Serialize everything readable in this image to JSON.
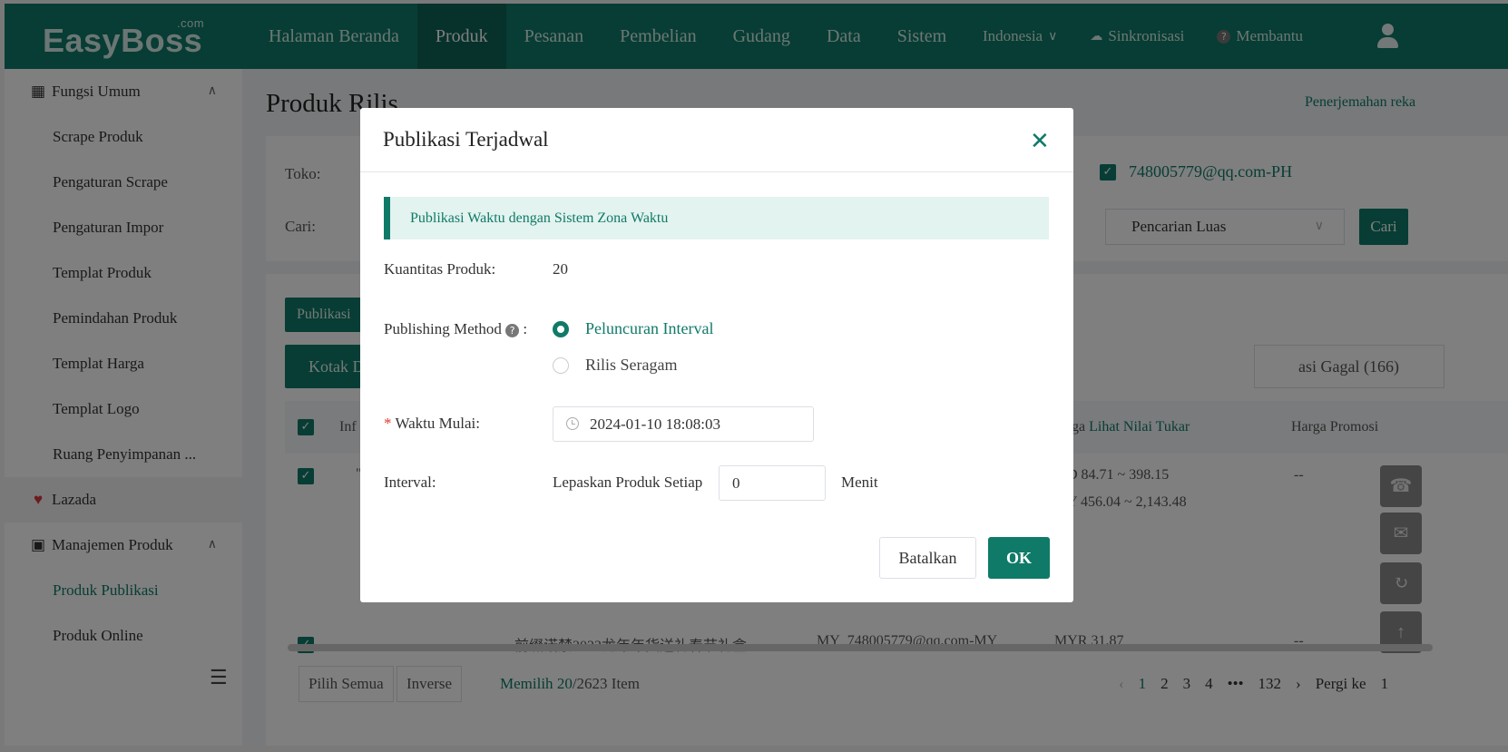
{
  "app": {
    "logo": "EasyBoss",
    "logo_sup": ".com"
  },
  "nav": {
    "items": [
      "Halaman Beranda",
      "Produk",
      "Pesanan",
      "Pembelian",
      "Gudang",
      "Data",
      "Sistem"
    ],
    "active": "Produk",
    "language": "Indonesia",
    "sync": "Sinkronisasi",
    "help": "Membantu"
  },
  "sidebar": {
    "group1": "Fungsi Umum",
    "items": [
      "Scrape Produk",
      "Pengaturan Scrape",
      "Pengaturan Impor",
      "Templat Produk",
      "Pemindahan Produk",
      "Templat Harga",
      "Templat Logo",
      "Ruang Penyimpanan ..."
    ],
    "lazada": "Lazada",
    "group2": "Manajemen Produk",
    "sub_items": [
      "Produk Publikasi",
      "Produk Online"
    ],
    "active": "Produk Publikasi"
  },
  "main": {
    "title": "Produk Rilis",
    "translate_link": "Penerjemahan reka",
    "filter": {
      "shop_label": "Toko:",
      "shop_checked": "748005779@qq.com-PH",
      "search_label": "Cari:",
      "search_mode": "Pencarian Luas",
      "search_button": "Cari"
    },
    "publish_button": "Publikasi",
    "tab_box": "Kotak D",
    "tab_failed": "asi Gagal (166)",
    "table": {
      "col_info": "Inf",
      "col_price_prefix": "rga ",
      "col_price_link": "Lihat Nilai Tukar",
      "col_promo": "Harga Promosi",
      "row1": {
        "name": "\"",
        "price1": "D 84.71 ~ 398.15",
        "price2": "Y 456.04 ~ 2,143.48",
        "promo": "--"
      },
      "row2": {
        "name": "前缀诺禁2023龙年年货送礼春节礼盒",
        "shop": "MY_748005779@qq.com-MY",
        "price": "MYR 31.87",
        "promo": "--"
      }
    },
    "footer": {
      "select_all": "Pilih Semua",
      "inverse": "Inverse",
      "selected_prefix": "Memilih",
      "selected_count": "20",
      "selected_total": "/2623 Item",
      "pages": [
        "1",
        "2",
        "3",
        "4",
        "•••",
        "132"
      ],
      "current_page": "1",
      "goto_label": "Pergi ke",
      "goto_value": "1"
    }
  },
  "modal": {
    "title": "Publikasi Terjadwal",
    "info": "Publikasi Waktu dengan Sistem Zona Waktu",
    "quantity_label": "Kuantitas Produk:",
    "quantity_value": "20",
    "method_label": "Publishing Method",
    "method_suffix": " :",
    "method_options": [
      "Peluncuran Interval",
      "Rilis Seragam"
    ],
    "method_selected": "Peluncuran Interval",
    "start_label": "Waktu Mulai:",
    "start_value": "2024-01-10 18:08:03",
    "interval_label": "Interval:",
    "interval_prefix": "Lepaskan Produk Setiap",
    "interval_value": "0",
    "interval_unit": "Menit",
    "cancel": "Batalkan",
    "ok": "OK"
  },
  "colors": {
    "brand": "#0f7a68",
    "required": "#e0392b"
  }
}
